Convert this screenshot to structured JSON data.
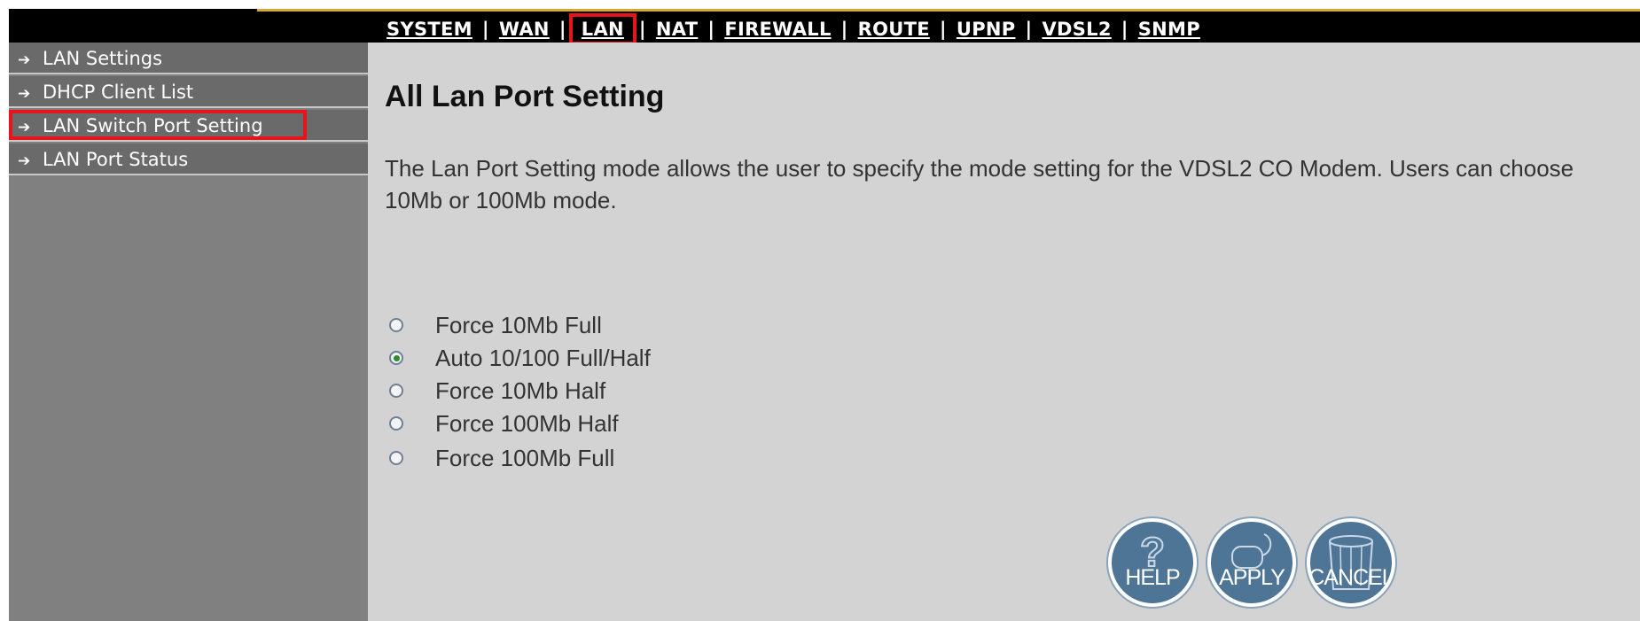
{
  "nav": {
    "items": [
      {
        "label": "SYSTEM"
      },
      {
        "label": "WAN"
      },
      {
        "label": "LAN"
      },
      {
        "label": "NAT"
      },
      {
        "label": "FIREWALL"
      },
      {
        "label": "ROUTE"
      },
      {
        "label": "UPNP"
      },
      {
        "label": "VDSL2"
      },
      {
        "label": "SNMP"
      }
    ],
    "separator": "|",
    "active": "LAN"
  },
  "sidebar": {
    "items": [
      {
        "label": "LAN Settings"
      },
      {
        "label": "DHCP Client List"
      },
      {
        "label": "LAN Switch Port Setting"
      },
      {
        "label": "LAN Port Status"
      }
    ],
    "selected": "LAN Switch Port Setting"
  },
  "main": {
    "title": "All Lan Port Setting",
    "description": "The Lan Port Setting mode allows the user to specify the mode setting for the VDSL2 CO Modem. Users can choose 10Mb or 100Mb mode.",
    "options": [
      {
        "label": "Force 10Mb Full",
        "checked": false
      },
      {
        "label": "Auto 10/100 Full/Half",
        "checked": true
      },
      {
        "label": "Force 10Mb Half",
        "checked": false
      },
      {
        "label": "Force 100Mb Half",
        "checked": false
      },
      {
        "label": "Force 100Mb Full",
        "checked": false
      }
    ]
  },
  "buttons": {
    "help": "HELP",
    "apply": "APPLY",
    "cancel": "CANCEL"
  },
  "colors": {
    "highlight": "#e8141c",
    "topbar": "#000000",
    "sidebar": "#808080",
    "content": "#d3d3d3",
    "button": "#4f7596"
  }
}
